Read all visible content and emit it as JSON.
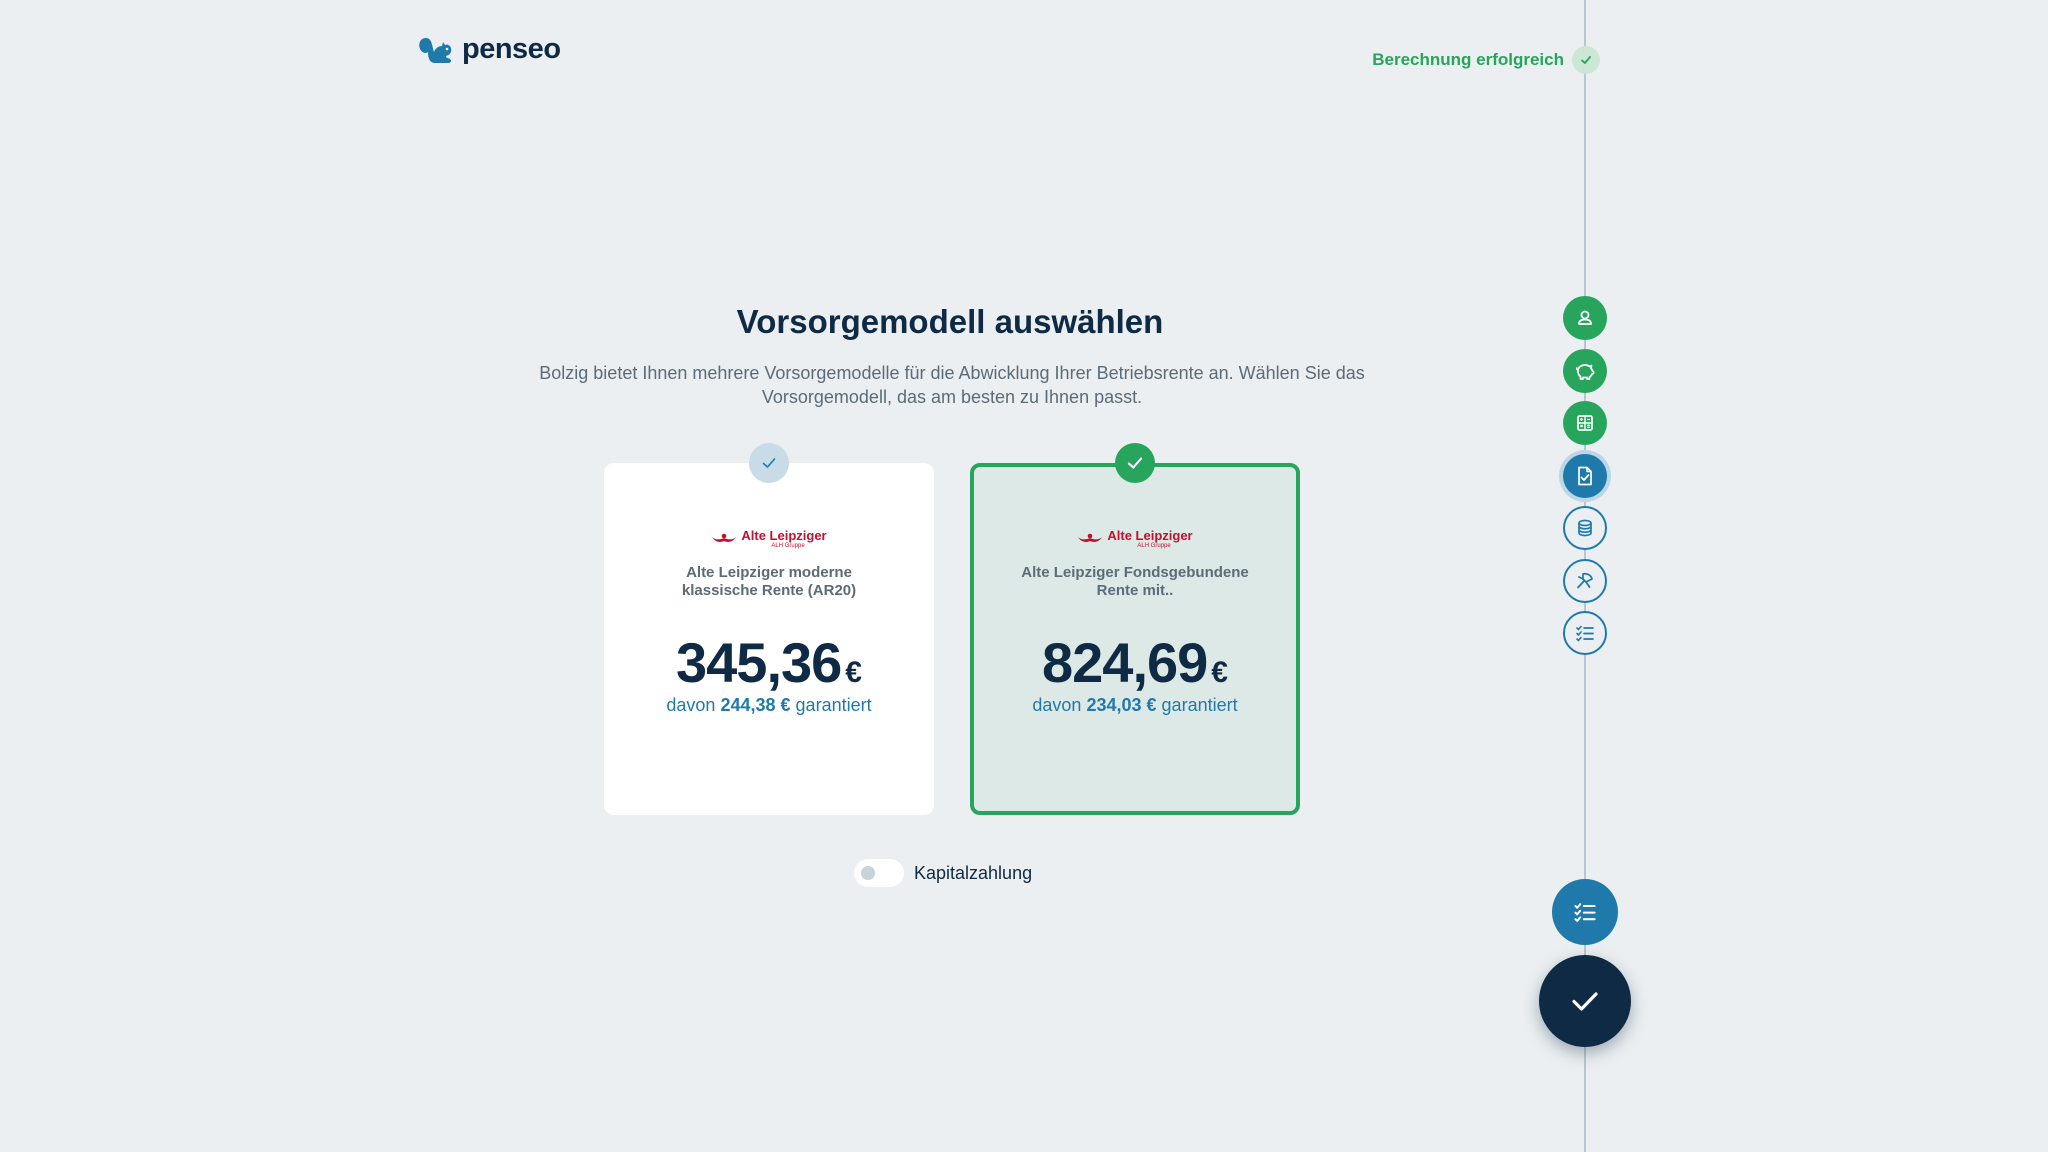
{
  "header": {
    "logo_text": "penseo",
    "status_text": "Berechnung erfolgreich"
  },
  "main": {
    "title": "Vorsorgemodell auswählen",
    "subtitle": "Bolzig bietet Ihnen mehrere Vorsorgemodelle für die Abwicklung Ihrer Betriebsrente an. Wählen Sie das Vorsorgemodell, das am besten zu Ihnen passt."
  },
  "cards": [
    {
      "insurer_name": "Alte Leipziger",
      "insurer_sub": "ALH Gruppe",
      "product": "Alte Leipziger moderne klassische Rente (AR20)",
      "price": "345,36",
      "currency": "€",
      "guarantee_prefix": "davon",
      "guarantee_amount": "244,38 €",
      "guarantee_suffix": "garantiert",
      "selected": false
    },
    {
      "insurer_name": "Alte Leipziger",
      "insurer_sub": "ALH Gruppe",
      "product": "Alte Leipziger Fondsgebundene Rente mit..",
      "price": "824,69",
      "currency": "€",
      "guarantee_prefix": "davon",
      "guarantee_amount": "234,03 €",
      "guarantee_suffix": "garantiert",
      "selected": true
    }
  ],
  "toggle": {
    "label": "Kapitalzahlung",
    "checked": false
  },
  "steps": [
    {
      "icon": "user-icon",
      "state": "done"
    },
    {
      "icon": "piggy-bank-icon",
      "state": "done"
    },
    {
      "icon": "calculator-icon",
      "state": "done"
    },
    {
      "icon": "document-check-icon",
      "state": "current"
    },
    {
      "icon": "database-icon",
      "state": "todo"
    },
    {
      "icon": "pen-tool-icon",
      "state": "todo"
    },
    {
      "icon": "checklist-icon",
      "state": "todo"
    }
  ],
  "colors": {
    "background": "#ebeff1",
    "primary_dark": "#0e2a44",
    "accent_blue": "#1f7aab",
    "success_green": "#27a55c",
    "insurer_red": "#c4102f"
  }
}
